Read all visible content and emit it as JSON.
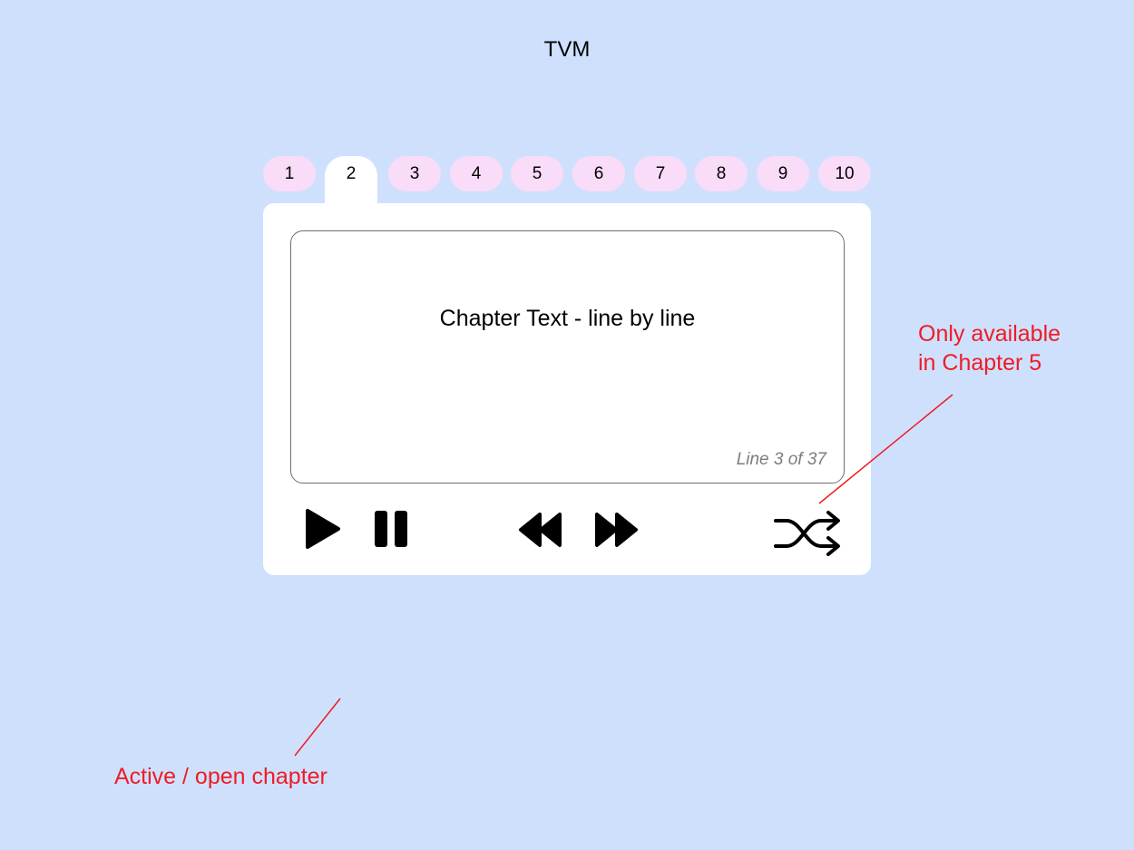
{
  "app": {
    "title": "TVM"
  },
  "chapter_tabs": [
    {
      "label": "1"
    },
    {
      "label": "2",
      "active": true
    },
    {
      "label": "3"
    },
    {
      "label": "4"
    },
    {
      "label": "5"
    },
    {
      "label": "6"
    },
    {
      "label": "7"
    },
    {
      "label": "8"
    },
    {
      "label": "9"
    },
    {
      "label": "10"
    }
  ],
  "text_panel": {
    "content": "Chapter Text - line by line",
    "line_counter": "Line 3 of 37"
  },
  "controls": {
    "play": {
      "icon": "play-icon"
    },
    "pause": {
      "icon": "pause-icon"
    },
    "rewind": {
      "icon": "rewind-icon"
    },
    "fast_forward": {
      "icon": "fast-forward-icon"
    },
    "shuffle": {
      "icon": "shuffle-icon"
    }
  },
  "annotations": {
    "shuffle_note_line1": "Only available",
    "shuffle_note_line2": "in Chapter 5",
    "active_tab_note": "Active / open chapter"
  },
  "colors": {
    "background": "#cfe0fd",
    "tab": "#f9dcf8",
    "panel": "#ffffff",
    "annotation": "#ee1c25"
  }
}
